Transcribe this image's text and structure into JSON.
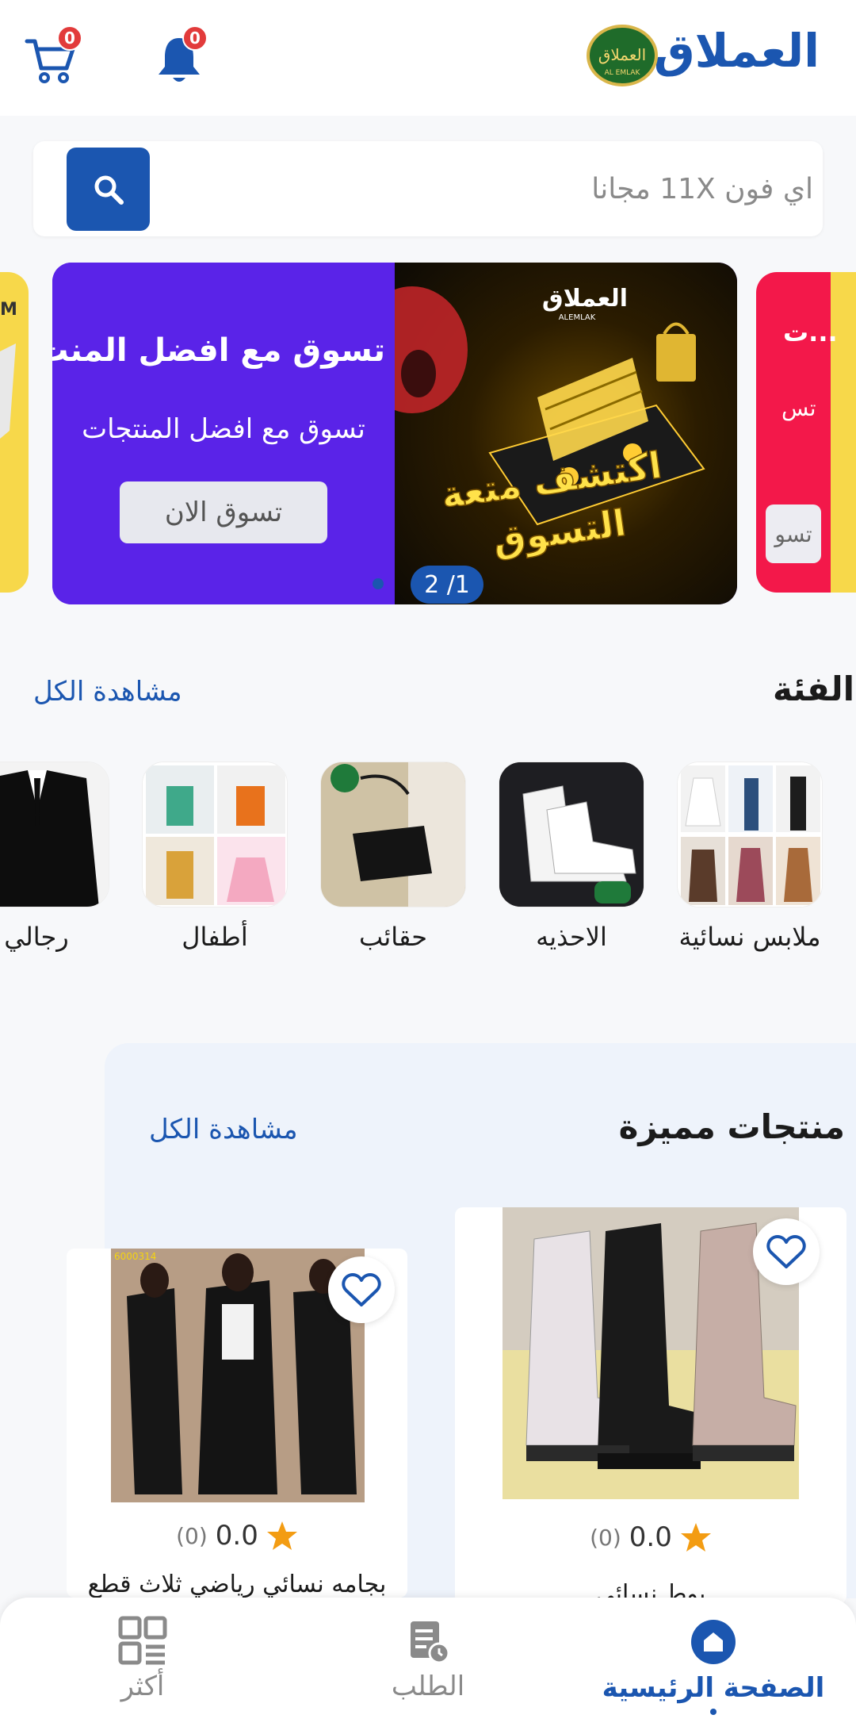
{
  "header": {
    "brand_title": "العملاق",
    "logo_text": "العملاق",
    "logo_subtext": "AL EMLAK",
    "cart_badge": "0",
    "notifications_badge": "0"
  },
  "search": {
    "placeholder": "اي فون 11X مجانا"
  },
  "banner": {
    "title": "تسوق مع افضل المنت...",
    "subtitle": "تسوق مع افضل المنتجات",
    "cta_label": "تسوق الان",
    "pager": "2 /1",
    "image_brand": "العملاق",
    "image_brand_sub": "ALEMLAK",
    "image_headline_1": "اكتشف متعة",
    "image_headline_2": "التسوق",
    "peek_right_title": "ت...",
    "peek_right_sub": "تس",
    "peek_right_button": "تسو",
    "peek_left_text": "M"
  },
  "categories": {
    "title": "الفئة",
    "view_all": "مشاهدة الكل",
    "items": [
      {
        "label": "ملابس نسائية"
      },
      {
        "label": "الاحذيه"
      },
      {
        "label": "حقائب"
      },
      {
        "label": "أطفال"
      },
      {
        "label": "رجالي"
      }
    ]
  },
  "featured": {
    "title": "منتجات مميزة",
    "view_all": "مشاهدة الكل",
    "products": [
      {
        "rating": "0.0",
        "count": "(0)",
        "name": "بوط نسائي"
      },
      {
        "rating": "0.0",
        "count": "(0)",
        "name": "بجامه نسائي رياضي ثلاث قطع",
        "code": "6000314"
      }
    ]
  },
  "bottom_nav": {
    "items": [
      {
        "label": "الصفحة الرئيسية"
      },
      {
        "label": "الطلب"
      },
      {
        "label": "أكثر"
      }
    ]
  },
  "colors": {
    "primary": "#1b56b0",
    "banner_purple": "#5a23e8",
    "badge_red": "#e23b3b",
    "star": "#f39c12"
  }
}
